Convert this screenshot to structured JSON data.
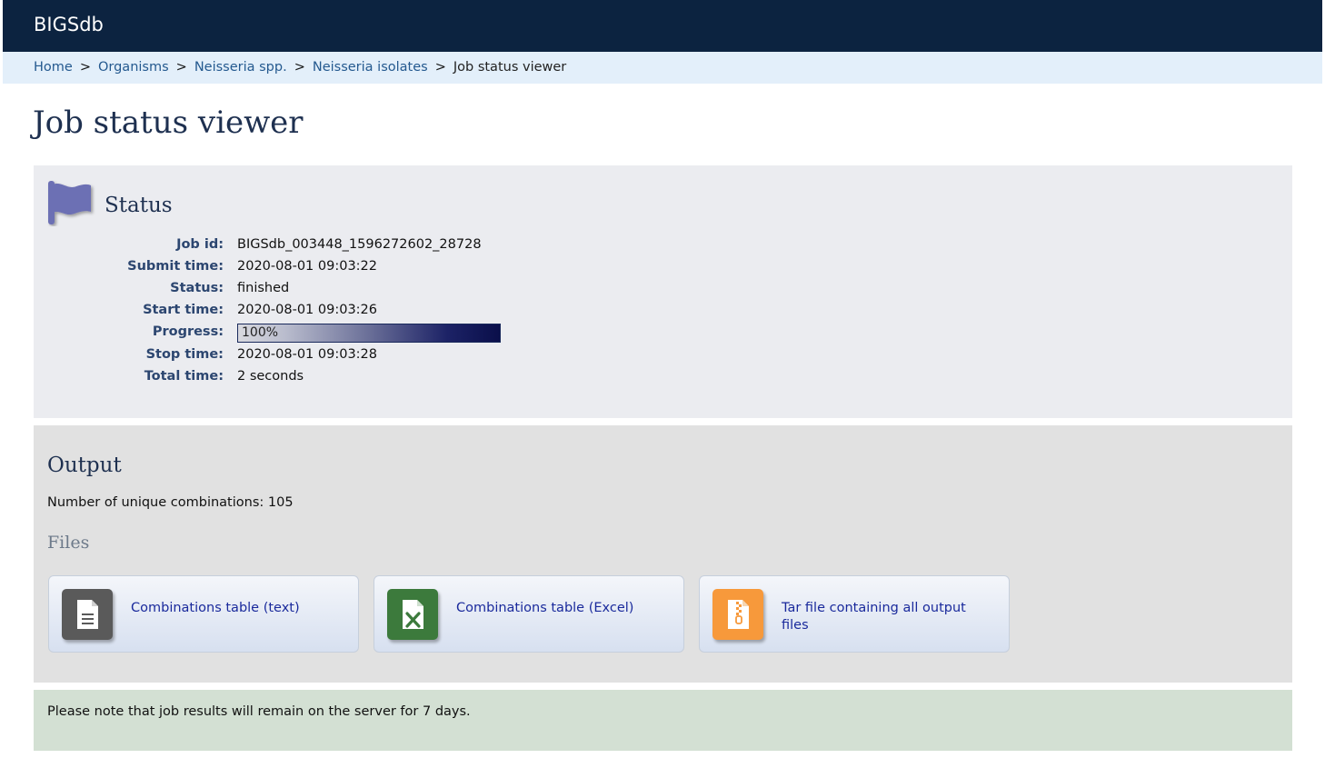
{
  "app": {
    "brand": "BIGSdb"
  },
  "breadcrumb": {
    "items": [
      "Home",
      "Organisms",
      "Neisseria spp.",
      "Neisseria isolates"
    ],
    "current": "Job status viewer",
    "separator": ">"
  },
  "page": {
    "title": "Job status viewer"
  },
  "status": {
    "heading": "Status",
    "icon": "flag-icon",
    "rows": {
      "job_id": {
        "label": "Job id:",
        "value": "BIGSdb_003448_1596272602_28728"
      },
      "submit_time": {
        "label": "Submit time:",
        "value": "2020-08-01 09:03:22"
      },
      "status": {
        "label": "Status:",
        "value": "finished"
      },
      "start_time": {
        "label": "Start time:",
        "value": "2020-08-01 09:03:26"
      },
      "progress": {
        "label": "Progress:",
        "value": "100%",
        "percent": 100
      },
      "stop_time": {
        "label": "Stop time:",
        "value": "2020-08-01 09:03:28"
      },
      "total_time": {
        "label": "Total time:",
        "value": "2 seconds"
      }
    }
  },
  "output": {
    "heading": "Output",
    "unique_combinations": "Number of unique combinations: 105",
    "files_heading": "Files",
    "files": [
      {
        "label": "Combinations table (text)",
        "icon": "text-file-icon",
        "color": "#5a5a5a"
      },
      {
        "label": "Combinations table (Excel)",
        "icon": "excel-file-icon",
        "color": "#3c7a3c"
      },
      {
        "label": "Tar file containing all output files",
        "icon": "archive-file-icon",
        "color": "#f7993b"
      }
    ]
  },
  "note": {
    "text": "Please note that job results will remain on the server for 7 days."
  },
  "colors": {
    "header_bg": "#0c2340",
    "breadcrumb_bg": "#e3effa",
    "link": "#24598f",
    "status_bg": "#ebecf0",
    "output_bg": "#e1e1e1",
    "note_bg": "#d3e0d3",
    "flag": "#6c6fb4"
  }
}
